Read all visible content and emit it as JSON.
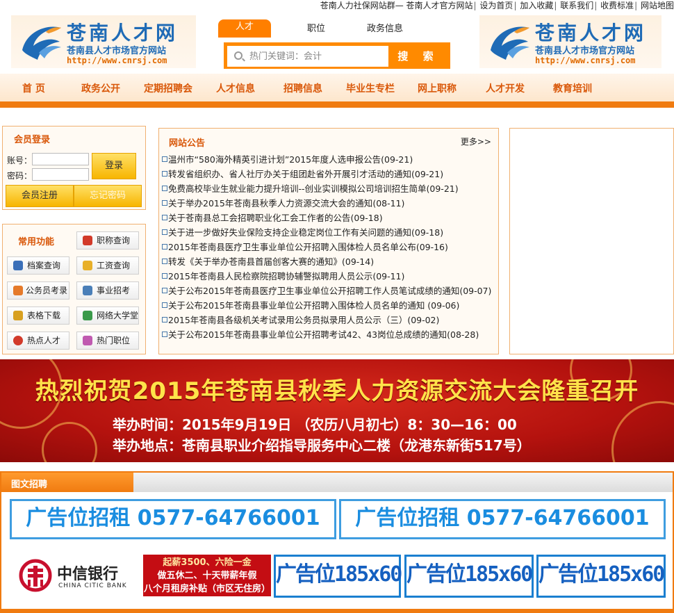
{
  "top_links": [
    "苍南人力社保网站群— 苍南人才官方网站",
    "设为首页",
    "加入收藏",
    "联系我们",
    "收费标准",
    "网站地图"
  ],
  "logo": {
    "title": "苍南人才网",
    "subtitle": "苍南县人才市场官方网站",
    "url": "http://www.cnrsj.com"
  },
  "search": {
    "tabs": [
      "人才",
      "职位",
      "政务信息"
    ],
    "placeholder": "热门关键词：会计",
    "button": "搜 索"
  },
  "nav": [
    "首 页",
    "政务公开",
    "定期招聘会",
    "人才信息",
    "招聘信息",
    "毕业生专栏",
    "网上职称",
    "人才开发",
    "教育培训"
  ],
  "login": {
    "title": "会员登录",
    "account_label": "账号：",
    "password_label": "密码：",
    "login_button": "登录",
    "register_button": "会员注册",
    "forgot_button": "忘记密码"
  },
  "functions": {
    "title": "常用功能",
    "items": [
      "职称查询",
      "档案查询",
      "工资查询",
      "公务员考录",
      "事业招考",
      "表格下载",
      "网络大学堂",
      "热点人才",
      "热门职位"
    ]
  },
  "notice": {
    "title": "网站公告",
    "more": "更多>>",
    "items": [
      "温州市“580海外精英引进计划”2015年度人选申报公告(09-21)",
      "转发省组织办、省人社厅办关于组团赴省外开展引才活动的通知(09-21)",
      "免费高校毕业生就业能力提升培训--创业实训模拟公司培训招生简单(09-21)",
      "关于举办2015年苍南县秋季人力资源交流大会的通知(08-11)",
      "关于苍南县总工会招聘职业化工会工作者的公告(09-18)",
      "关于进一步做好失业保险支持企业稳定岗位工作有关问题的通知(09-18)",
      "2015年苍南县医疗卫生事业单位公开招聘入围体检人员名单公布(09-16)",
      "转发《关于举办苍南县首届创客大赛的通知》(09-14)",
      "2015年苍南县人民检察院招聘协辅警拟聘用人员公示(09-11)",
      "关于公布2015年苍南县医疗卫生事业单位公开招聘工作人员笔试成绩的通知(09-07)",
      "关于公布2015年苍南县事业单位公开招聘入围体检人员名单的通知 (09-06)",
      "2015年苍南县各级机关考试录用公务员拟录用人员公示（三）(09-02)",
      "关于公布2015年苍南县事业单位公开招聘考试42、43岗位总成绩的通知(08-28)"
    ]
  },
  "banner": {
    "headline": "热烈祝贺2015年苍南县秋季人力资源交流大会隆重召开",
    "time": "举办时间：2015年9月19日 （农历八月初七）8：30—16：00",
    "place": "举办地点：苍南县职业介绍指导服务中心二楼（龙港东新街517号）"
  },
  "ads": {
    "title": "图文招聘",
    "big": [
      "广告位招租 0577-64766001",
      "广告位招租 0577-64766001"
    ],
    "bank_name": "中信银行",
    "bank_en": "CHINA CITIC BANK",
    "promo": [
      "起薪3500、六险一金",
      "做五休二、十天带薪年假",
      "八个月租房补贴（市区无住房）"
    ],
    "small": [
      "广告位185x60",
      "广告位185x60",
      "广告位185x60"
    ]
  },
  "colors": {
    "orange": "#f07b10",
    "nav_text": "#d9580a",
    "logo_blue": "#1f6bb6",
    "ad_blue": "#1a8de0",
    "banner_red": "#b4120e",
    "banner_yellow": "#ffe34a"
  }
}
